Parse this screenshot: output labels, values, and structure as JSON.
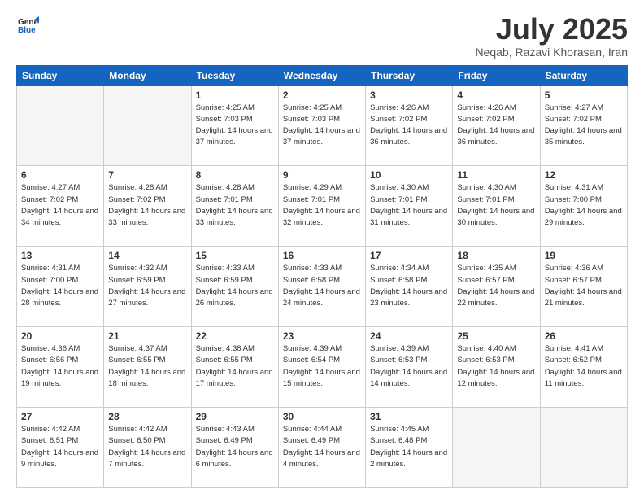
{
  "header": {
    "logo": {
      "general": "General",
      "blue": "Blue"
    },
    "title": "July 2025",
    "location": "Neqab, Razavi Khorasan, Iran"
  },
  "weekdays": [
    "Sunday",
    "Monday",
    "Tuesday",
    "Wednesday",
    "Thursday",
    "Friday",
    "Saturday"
  ],
  "weeks": [
    [
      {
        "day": "",
        "empty": true
      },
      {
        "day": "",
        "empty": true
      },
      {
        "day": "1",
        "sunrise": "4:25 AM",
        "sunset": "7:03 PM",
        "daylight": "14 hours and 37 minutes."
      },
      {
        "day": "2",
        "sunrise": "4:25 AM",
        "sunset": "7:03 PM",
        "daylight": "14 hours and 37 minutes."
      },
      {
        "day": "3",
        "sunrise": "4:26 AM",
        "sunset": "7:02 PM",
        "daylight": "14 hours and 36 minutes."
      },
      {
        "day": "4",
        "sunrise": "4:26 AM",
        "sunset": "7:02 PM",
        "daylight": "14 hours and 36 minutes."
      },
      {
        "day": "5",
        "sunrise": "4:27 AM",
        "sunset": "7:02 PM",
        "daylight": "14 hours and 35 minutes."
      }
    ],
    [
      {
        "day": "6",
        "sunrise": "4:27 AM",
        "sunset": "7:02 PM",
        "daylight": "14 hours and 34 minutes."
      },
      {
        "day": "7",
        "sunrise": "4:28 AM",
        "sunset": "7:02 PM",
        "daylight": "14 hours and 33 minutes."
      },
      {
        "day": "8",
        "sunrise": "4:28 AM",
        "sunset": "7:01 PM",
        "daylight": "14 hours and 33 minutes."
      },
      {
        "day": "9",
        "sunrise": "4:29 AM",
        "sunset": "7:01 PM",
        "daylight": "14 hours and 32 minutes."
      },
      {
        "day": "10",
        "sunrise": "4:30 AM",
        "sunset": "7:01 PM",
        "daylight": "14 hours and 31 minutes."
      },
      {
        "day": "11",
        "sunrise": "4:30 AM",
        "sunset": "7:01 PM",
        "daylight": "14 hours and 30 minutes."
      },
      {
        "day": "12",
        "sunrise": "4:31 AM",
        "sunset": "7:00 PM",
        "daylight": "14 hours and 29 minutes."
      }
    ],
    [
      {
        "day": "13",
        "sunrise": "4:31 AM",
        "sunset": "7:00 PM",
        "daylight": "14 hours and 28 minutes."
      },
      {
        "day": "14",
        "sunrise": "4:32 AM",
        "sunset": "6:59 PM",
        "daylight": "14 hours and 27 minutes."
      },
      {
        "day": "15",
        "sunrise": "4:33 AM",
        "sunset": "6:59 PM",
        "daylight": "14 hours and 26 minutes."
      },
      {
        "day": "16",
        "sunrise": "4:33 AM",
        "sunset": "6:58 PM",
        "daylight": "14 hours and 24 minutes."
      },
      {
        "day": "17",
        "sunrise": "4:34 AM",
        "sunset": "6:58 PM",
        "daylight": "14 hours and 23 minutes."
      },
      {
        "day": "18",
        "sunrise": "4:35 AM",
        "sunset": "6:57 PM",
        "daylight": "14 hours and 22 minutes."
      },
      {
        "day": "19",
        "sunrise": "4:36 AM",
        "sunset": "6:57 PM",
        "daylight": "14 hours and 21 minutes."
      }
    ],
    [
      {
        "day": "20",
        "sunrise": "4:36 AM",
        "sunset": "6:56 PM",
        "daylight": "14 hours and 19 minutes."
      },
      {
        "day": "21",
        "sunrise": "4:37 AM",
        "sunset": "6:55 PM",
        "daylight": "14 hours and 18 minutes."
      },
      {
        "day": "22",
        "sunrise": "4:38 AM",
        "sunset": "6:55 PM",
        "daylight": "14 hours and 17 minutes."
      },
      {
        "day": "23",
        "sunrise": "4:39 AM",
        "sunset": "6:54 PM",
        "daylight": "14 hours and 15 minutes."
      },
      {
        "day": "24",
        "sunrise": "4:39 AM",
        "sunset": "6:53 PM",
        "daylight": "14 hours and 14 minutes."
      },
      {
        "day": "25",
        "sunrise": "4:40 AM",
        "sunset": "6:53 PM",
        "daylight": "14 hours and 12 minutes."
      },
      {
        "day": "26",
        "sunrise": "4:41 AM",
        "sunset": "6:52 PM",
        "daylight": "14 hours and 11 minutes."
      }
    ],
    [
      {
        "day": "27",
        "sunrise": "4:42 AM",
        "sunset": "6:51 PM",
        "daylight": "14 hours and 9 minutes."
      },
      {
        "day": "28",
        "sunrise": "4:42 AM",
        "sunset": "6:50 PM",
        "daylight": "14 hours and 7 minutes."
      },
      {
        "day": "29",
        "sunrise": "4:43 AM",
        "sunset": "6:49 PM",
        "daylight": "14 hours and 6 minutes."
      },
      {
        "day": "30",
        "sunrise": "4:44 AM",
        "sunset": "6:49 PM",
        "daylight": "14 hours and 4 minutes."
      },
      {
        "day": "31",
        "sunrise": "4:45 AM",
        "sunset": "6:48 PM",
        "daylight": "14 hours and 2 minutes."
      },
      {
        "day": "",
        "empty": true
      },
      {
        "day": "",
        "empty": true
      }
    ]
  ]
}
